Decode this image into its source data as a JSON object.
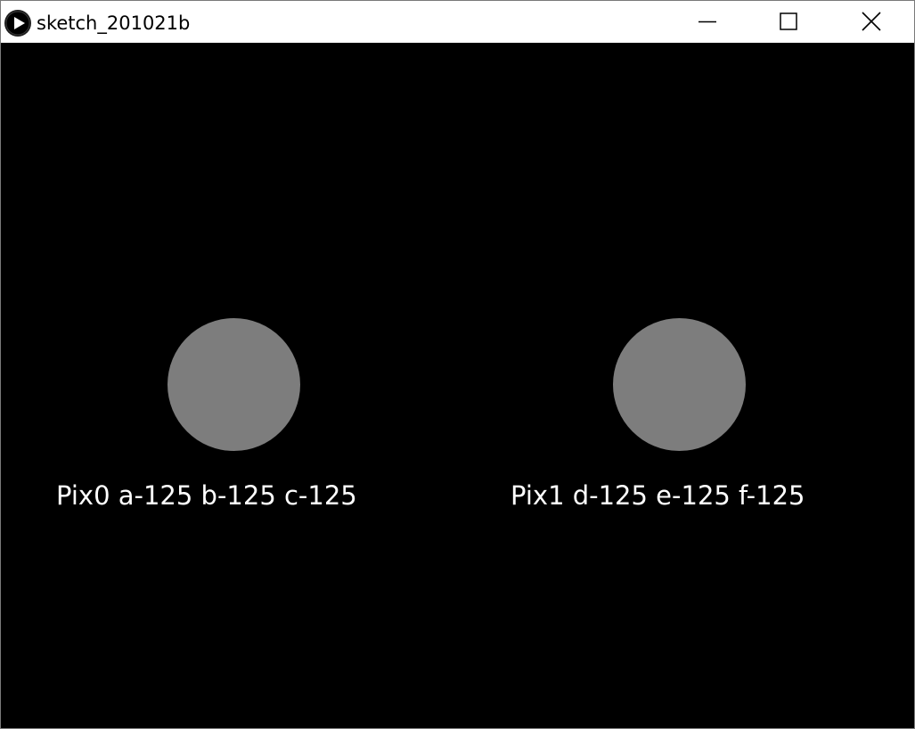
{
  "window": {
    "title": "sketch_201021b",
    "icon": "processing-play-icon",
    "controls": {
      "minimize": "minimize-icon",
      "maximize": "maximize-icon",
      "close": "close-icon"
    }
  },
  "canvas": {
    "background": "#000000",
    "pixels": [
      {
        "label": "Pix0 a-125 b-125 c-125",
        "color": "#7d7d7d"
      },
      {
        "label": "Pix1 d-125 e-125 f-125",
        "color": "#7d7d7d"
      }
    ]
  }
}
